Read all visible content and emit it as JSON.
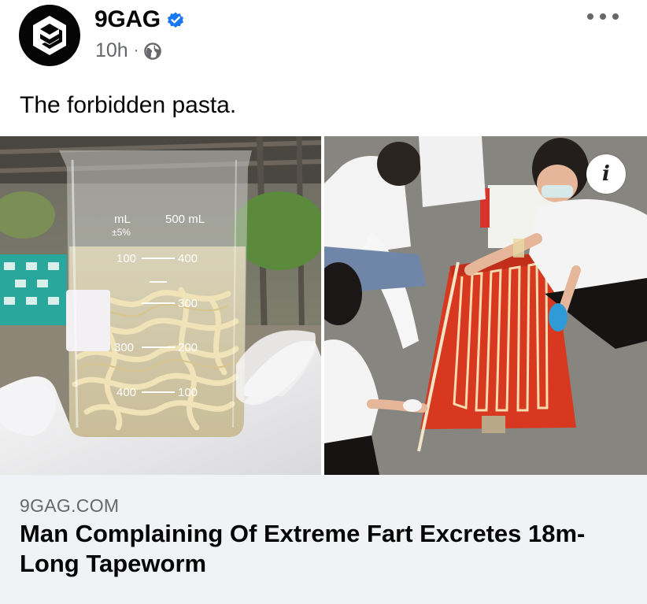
{
  "post": {
    "page_name": "9GAG",
    "time": "10h",
    "separator": "·",
    "verified_icon": "verified-badge-icon",
    "audience_icon": "globe-icon",
    "caption": "The forbidden pasta."
  },
  "media": {
    "left_photo": {
      "beaker_scale_labels": [
        "mL",
        "500 mL",
        "±5%",
        "100",
        "400",
        "300",
        "300",
        "200",
        "400",
        "100"
      ]
    }
  },
  "link": {
    "domain": "9GAG.COM",
    "title": "Man Complaining Of Extreme Fart Excretes 18m-Long Tapeworm"
  },
  "colors": {
    "verified_blue": "#1877f2",
    "secondary_text": "#65676b",
    "card_background": "#f0f2f5",
    "tarp_red": "#d8381f"
  }
}
